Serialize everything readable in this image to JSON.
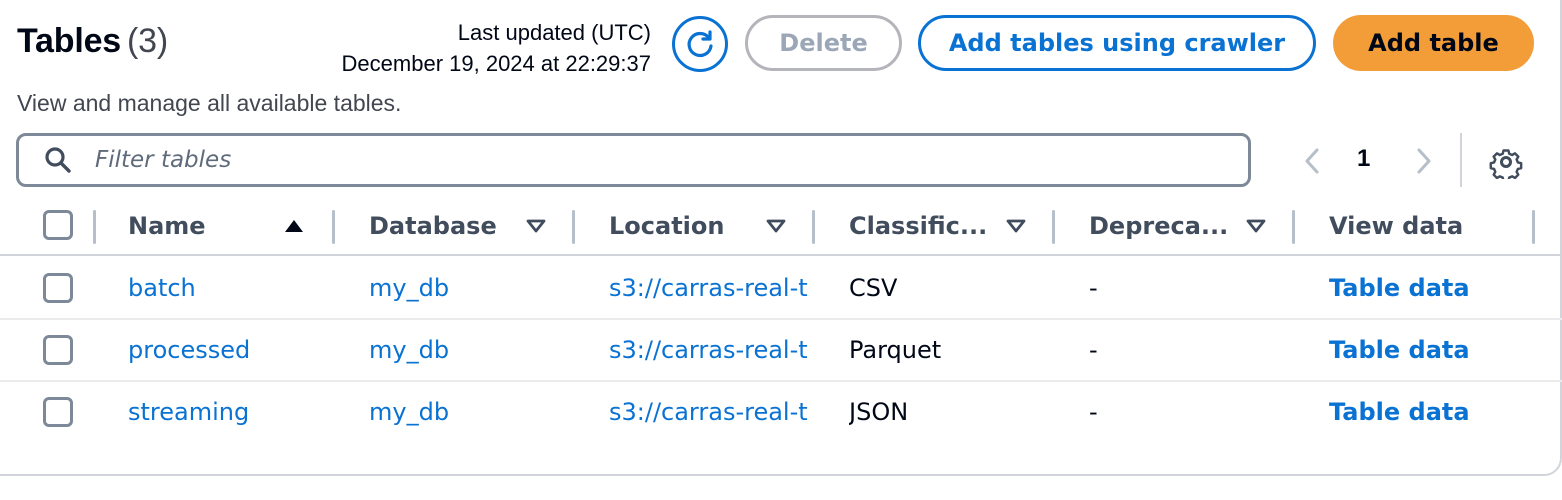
{
  "header": {
    "title": "Tables",
    "count": "(3)",
    "description": "View and manage all available tables.",
    "last_updated_label": "Last updated (UTC)",
    "last_updated_value": "December 19, 2024 at 22:29:37"
  },
  "actions": {
    "refresh_icon": "refresh-icon",
    "delete_label": "Delete",
    "crawler_label": "Add tables using crawler",
    "add_label": "Add table"
  },
  "filter": {
    "placeholder": "Filter tables",
    "value": ""
  },
  "pagination": {
    "current_page": "1"
  },
  "table": {
    "columns": [
      {
        "label": "Name",
        "sort": "ascending"
      },
      {
        "label": "Database",
        "sort": "none"
      },
      {
        "label": "Location",
        "sort": "none"
      },
      {
        "label": "Classific...",
        "sort": "none"
      },
      {
        "label": "Depreca...",
        "sort": "none"
      },
      {
        "label": "View data",
        "sort": ""
      }
    ],
    "rows": [
      {
        "name": "batch",
        "database": "my_db",
        "location": "s3://carras-real-t",
        "classification": "CSV",
        "deprecated": "-",
        "view": "Table data"
      },
      {
        "name": "processed",
        "database": "my_db",
        "location": "s3://carras-real-t",
        "classification": "Parquet",
        "deprecated": "-",
        "view": "Table data"
      },
      {
        "name": "streaming",
        "database": "my_db",
        "location": "s3://carras-real-t",
        "classification": "JSON",
        "deprecated": "-",
        "view": "Table data"
      }
    ]
  },
  "colors": {
    "link": "#0972d3",
    "primary_button": "#f29d38",
    "text": "#000716",
    "border": "#7d8998"
  }
}
